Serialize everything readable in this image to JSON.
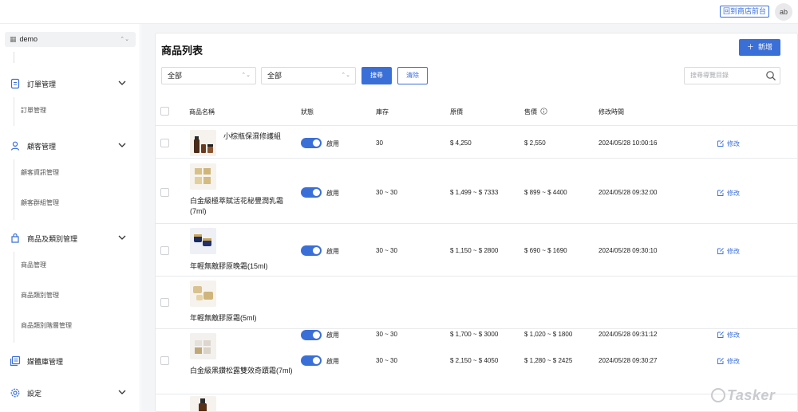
{
  "topbar": {
    "front_link": "回到商店前台",
    "avatar": "ab"
  },
  "sidebar": {
    "store": "demo",
    "groups": [
      {
        "label": "訂單管理",
        "icon": "document-icon",
        "items": [
          "訂單管理"
        ]
      },
      {
        "label": "顧客管理",
        "icon": "user-icon",
        "items": [
          "顧客資訊管理",
          "顧客群組管理"
        ]
      },
      {
        "label": "商品及類別管理",
        "icon": "shopping-bag-icon",
        "items": [
          "商品管理",
          "商品類別管理",
          "商品類別階層管理"
        ]
      },
      {
        "label": "媒體庫管理",
        "icon": "media-library-icon",
        "items": []
      },
      {
        "label": "設定",
        "icon": "gear-icon",
        "items": []
      }
    ]
  },
  "main": {
    "title": "商品列表",
    "add_button": "新增",
    "filter1": "全部",
    "filter2": "全部",
    "search_button": "搜尋",
    "clear_button": "清除",
    "search_placeholder": "搜尋導覽目錄",
    "columns": [
      "商品名稱",
      "狀態",
      "庫存",
      "原價",
      "售價",
      "修改時間"
    ],
    "rows": [
      {
        "name": "小棕瓶保濕修護組",
        "status": "啟用",
        "stock": "30",
        "original": "$ 4,250",
        "price": "$ 2,550",
        "modified": "2024/05/28 10:00:16",
        "edit": "修改"
      },
      {
        "name": "白金級極萃賦活花秘豐潤乳霜(7ml)",
        "status": "啟用",
        "stock": "30 ~ 30",
        "original": "$ 1,499 ~ $ 7333",
        "price": "$ 899 ~ $ 4400",
        "modified": "2024/05/28 09:32:00",
        "edit": "修改"
      },
      {
        "name": "年輕無敵膠原晚霜(15ml)",
        "status": "啟用",
        "stock": "30 ~ 30",
        "original": "$ 1,150 ~ $ 2800",
        "price": "$ 690 ~ $ 1690",
        "modified": "2024/05/28 09:30:10",
        "edit": "修改"
      },
      {
        "name": "年輕無敵膠原霜(5ml)",
        "status": "啟用",
        "stock": "30 ~ 30",
        "original": "$ 1,700 ~ $ 3000",
        "price": "$ 1,020 ~ $ 1800",
        "modified": "2024/05/28 09:31:12",
        "edit": "修改"
      },
      {
        "name": "白金級黑鑽松露雙效奇蹟霜(7ml)",
        "status": "啟用",
        "stock": "30 ~ 30",
        "original": "$ 2,150 ~ $ 4050",
        "price": "$ 1,280 ~ $ 2425",
        "modified": "2024/05/28 09:30:27",
        "edit": "修改"
      }
    ]
  },
  "watermark": "Tasker",
  "colors": {
    "accent": "#3a6fd8",
    "background": "#f4f5f7"
  }
}
